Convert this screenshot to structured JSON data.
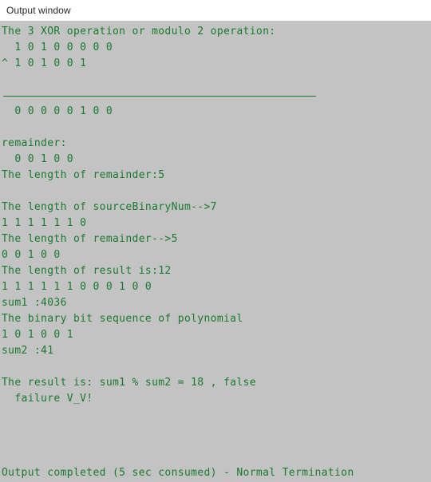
{
  "window": {
    "title": "Output window",
    "background_color": "#c3c3c3",
    "header_background_color": "#ffffff",
    "text_color": "#1a7a2e",
    "title_color": "#262626"
  },
  "console": {
    "lines": [
      {
        "text": "The 3 XOR operation or modulo 2 operation:",
        "type": "text"
      },
      {
        "text": "  1 0 1 0 0 0 0 0",
        "type": "text"
      },
      {
        "text": "^ 1 0 1 0 0 1",
        "type": "text"
      },
      {
        "text": "",
        "type": "blank"
      },
      {
        "text": "",
        "type": "rule"
      },
      {
        "text": "  0 0 0 0 0 1 0 0",
        "type": "text"
      },
      {
        "text": "",
        "type": "blank"
      },
      {
        "text": "remainder:",
        "type": "text"
      },
      {
        "text": "  0 0 1 0 0",
        "type": "text"
      },
      {
        "text": "The length of remainder:5",
        "type": "text"
      },
      {
        "text": "",
        "type": "blank"
      },
      {
        "text": "The length of sourceBinaryNum-->7",
        "type": "text"
      },
      {
        "text": "1 1 1 1 1 1 0",
        "type": "text"
      },
      {
        "text": "The length of remainder-->5",
        "type": "text"
      },
      {
        "text": "0 0 1 0 0",
        "type": "text"
      },
      {
        "text": "The length of result is:12",
        "type": "text"
      },
      {
        "text": "1 1 1 1 1 1 0 0 0 1 0 0",
        "type": "text"
      },
      {
        "text": "sum1 :4036",
        "type": "text"
      },
      {
        "text": "The binary bit sequence of polynomial",
        "type": "text"
      },
      {
        "text": "1 0 1 0 0 1",
        "type": "text"
      },
      {
        "text": "sum2 :41",
        "type": "text"
      },
      {
        "text": "",
        "type": "blank"
      },
      {
        "text": "The result is: sum1 % sum2 = 18 , false",
        "type": "text"
      },
      {
        "text": "  failure V_V!",
        "type": "text"
      }
    ]
  },
  "status": {
    "text": "Output completed (5 sec consumed) - Normal Termination"
  }
}
